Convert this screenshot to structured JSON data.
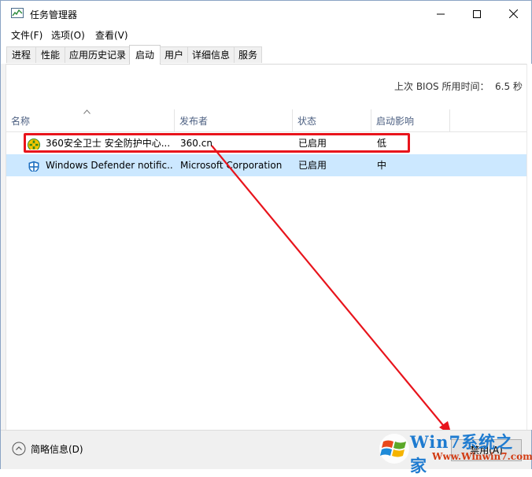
{
  "window": {
    "title": "任务管理器"
  },
  "menu": [
    {
      "label": "文件(F)"
    },
    {
      "label": "选项(O)"
    },
    {
      "label": "查看(V)"
    }
  ],
  "tabs": [
    {
      "label": "进程"
    },
    {
      "label": "性能"
    },
    {
      "label": "应用历史记录"
    },
    {
      "label": "启动",
      "active": true
    },
    {
      "label": "用户"
    },
    {
      "label": "详细信息"
    },
    {
      "label": "服务"
    }
  ],
  "bios": {
    "label": "上次 BIOS 所用时间：",
    "value": "6.5 秒"
  },
  "columns": [
    {
      "label": "名称"
    },
    {
      "label": "发布者"
    },
    {
      "label": "状态"
    },
    {
      "label": "启动影响"
    }
  ],
  "rows": [
    {
      "name": "360安全卫士 安全防护中心...",
      "publisher": "360.cn",
      "status": "已启用",
      "impact": "低",
      "icon": "360-safeguard-icon"
    },
    {
      "name": "Windows Defender notific...",
      "publisher": "Microsoft Corporation",
      "status": "已启用",
      "impact": "中",
      "icon": "windows-defender-shield-icon",
      "selected": true
    }
  ],
  "footer": {
    "fewer_details": "简略信息(D)",
    "disable_button": "禁用(A)"
  },
  "watermark": {
    "brand": "Win7系统之家",
    "url": "Www.Winwin7.com"
  },
  "colors": {
    "annotation": "#e8141c",
    "selection": "#cce8ff",
    "header_text": "#4d6082"
  }
}
